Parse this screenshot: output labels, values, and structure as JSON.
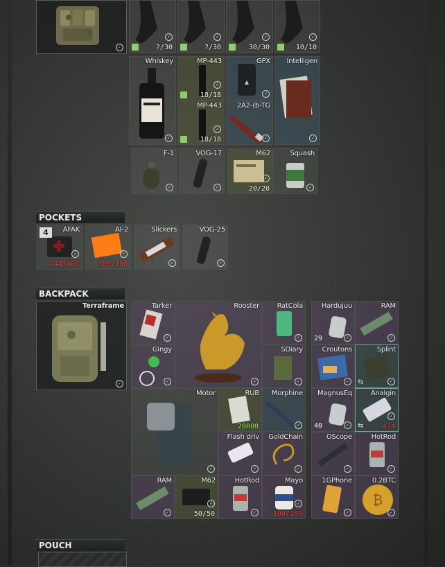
{
  "rig": {
    "mags": [
      {
        "count": "?/30"
      },
      {
        "count": "?/30"
      },
      {
        "count": "30/30"
      },
      {
        "count": "10/10"
      }
    ],
    "row2": [
      {
        "name": "Whiskey"
      },
      {
        "name": "MP-443",
        "count": "18/18"
      },
      {
        "name": "MP-443",
        "count": "18/18"
      },
      {
        "name": "GPX"
      },
      {
        "name": "2A2-(b-TG"
      },
      {
        "name": "Intelligen"
      }
    ],
    "row3": [
      {
        "name": "F-1"
      },
      {
        "name": "VOG-17"
      },
      {
        "name": "M62",
        "count": "20/20"
      },
      {
        "name": "Squash"
      }
    ]
  },
  "pockets": {
    "header": "POCKETS",
    "items": [
      {
        "name": "AFAK",
        "count": "244/400",
        "badge": "4"
      },
      {
        "name": "AI-2",
        "count": "100/100"
      },
      {
        "name": "Slickers"
      },
      {
        "name": "VOG-25"
      }
    ]
  },
  "backpack": {
    "header": "BACKPACK",
    "name": "Terraframe",
    "left": [
      {
        "name": "Tarker"
      },
      {
        "name": "Rooster"
      },
      {
        "name": "RatCola"
      },
      {
        "name": "Gingy"
      },
      {
        "name": "SDiary"
      },
      {
        "name": "Motor"
      },
      {
        "name": "RUB",
        "count": "20000"
      },
      {
        "name": "Morphine"
      },
      {
        "name": "Flash driv"
      },
      {
        "name": "GoldChain"
      },
      {
        "name": "RAM"
      },
      {
        "name": "M62",
        "count": "50/50"
      },
      {
        "name": "HotRod"
      },
      {
        "name": "Mayo",
        "count": "100/100"
      }
    ],
    "right": [
      {
        "name": "Hardujuu",
        "count": "29"
      },
      {
        "name": "RAM"
      },
      {
        "name": "Croutons"
      },
      {
        "name": "Splint"
      },
      {
        "name": "MagnusEq",
        "count": "40"
      },
      {
        "name": "Analgin",
        "count": "4/4"
      },
      {
        "name": "OScope"
      },
      {
        "name": "HotRod"
      },
      {
        "name": "1GPhone"
      },
      {
        "name": "0.2BTC"
      }
    ]
  },
  "pouch": {
    "header": "POUCH"
  }
}
